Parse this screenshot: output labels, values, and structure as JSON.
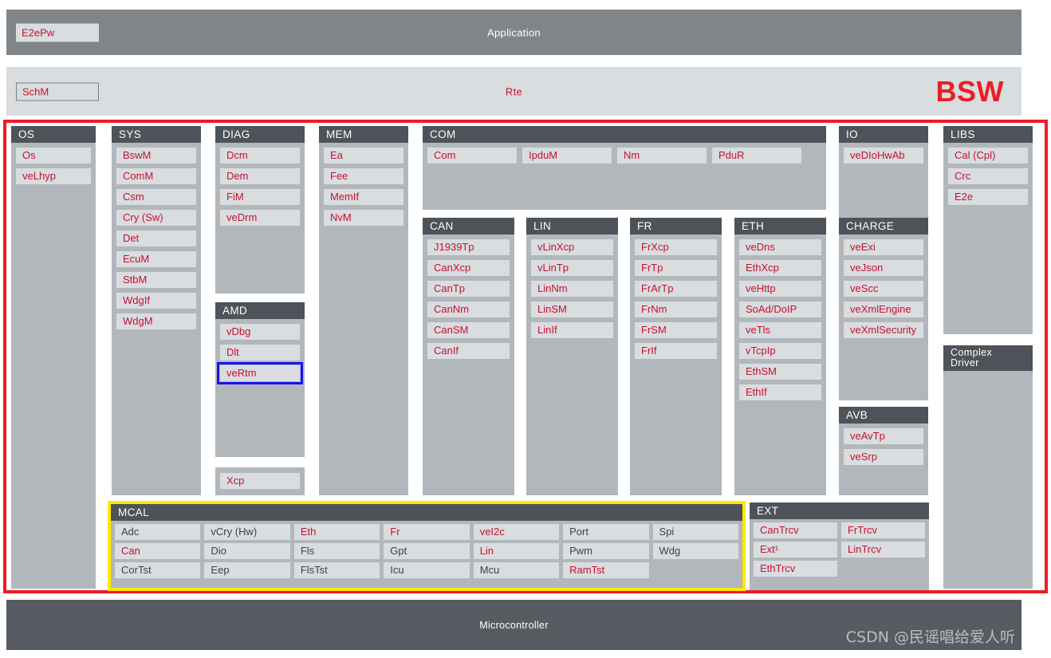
{
  "layers": {
    "application": {
      "title": "Application",
      "chip": "E2ePw"
    },
    "rte": {
      "title": "Rte",
      "chip": "SchM",
      "badge": "BSW"
    },
    "microcontroller": {
      "title": "Microcontroller"
    }
  },
  "watermark": "CSDN @民谣唱给爱人听",
  "colors": {
    "accent_red": "#c8102e",
    "frame_red": "#ee1c25",
    "frame_yellow": "#ffe800",
    "highlight_blue": "#1515ee",
    "header_gray": "#4d5358",
    "body_gray": "#b2b7bc",
    "chip_gray": "#d9dde0",
    "app_bar_gray": "#808589",
    "footer_gray": "#565c61"
  },
  "groups": {
    "os": {
      "title": "OS",
      "items": [
        "Os",
        "veLhyp"
      ]
    },
    "sys": {
      "title": "SYS",
      "items": [
        "BswM",
        "ComM",
        "Csm",
        "Cry (Sw)",
        "Det",
        "EcuM",
        "StbM",
        "WdgIf",
        "WdgM"
      ]
    },
    "diag": {
      "title": "DIAG",
      "items": [
        "Dcm",
        "Dem",
        "FiM",
        "veDrm"
      ]
    },
    "amd": {
      "title": "AMD",
      "items": [
        "vDbg",
        "Dlt",
        "veRtm"
      ],
      "highlighted": "veRtm"
    },
    "xcp": {
      "items": [
        "Xcp"
      ]
    },
    "mem": {
      "title": "MEM",
      "items": [
        "Ea",
        "Fee",
        "MemIf",
        "NvM"
      ]
    },
    "com": {
      "title": "COM",
      "items": [
        "Com",
        "IpduM",
        "Nm",
        "PduR"
      ]
    },
    "can": {
      "title": "CAN",
      "items": [
        "J1939Tp",
        "CanXcp",
        "CanTp",
        "CanNm",
        "CanSM",
        "CanIf"
      ]
    },
    "lin": {
      "title": "LIN",
      "items": [
        "vLinXcp",
        "vLinTp",
        "LinNm",
        "LinSM",
        "LinIf"
      ]
    },
    "fr": {
      "title": "FR",
      "items": [
        "FrXcp",
        "FrTp",
        "FrArTp",
        "FrNm",
        "FrSM",
        "FrIf"
      ]
    },
    "eth": {
      "title": "ETH",
      "items": [
        "veDns",
        "EthXcp",
        "veHttp",
        "SoAd/DoIP",
        "veTls",
        "vTcpIp",
        "EthSM",
        "EthIf"
      ]
    },
    "io": {
      "title": "IO",
      "items": [
        "veDIoHwAb"
      ]
    },
    "charge": {
      "title": "CHARGE",
      "items": [
        "veExi",
        "veJson",
        "veScc",
        "veXmlEngine",
        "veXmlSecurity"
      ]
    },
    "avb": {
      "title": "AVB",
      "items": [
        "veAvTp",
        "veSrp"
      ]
    },
    "libs": {
      "title": "LIBS",
      "items": [
        "Cal (Cpl)",
        "Crc",
        "E2e"
      ]
    },
    "complex_driver": {
      "title": "Complex\nDriver",
      "items": []
    },
    "mcal": {
      "title": "MCAL",
      "columns": [
        {
          "cells": [
            {
              "label": "Adc",
              "red": false
            },
            {
              "label": "Can",
              "red": true
            },
            {
              "label": "CorTst",
              "red": false
            }
          ]
        },
        {
          "cells": [
            {
              "label": "vCry (Hw)",
              "red": false
            },
            {
              "label": "Dio",
              "red": false
            },
            {
              "label": "Eep",
              "red": false
            }
          ]
        },
        {
          "cells": [
            {
              "label": "Eth",
              "red": true
            },
            {
              "label": "Fls",
              "red": false
            },
            {
              "label": "FlsTst",
              "red": false
            }
          ]
        },
        {
          "cells": [
            {
              "label": "Fr",
              "red": true
            },
            {
              "label": "Gpt",
              "red": false
            },
            {
              "label": "Icu",
              "red": false
            }
          ]
        },
        {
          "cells": [
            {
              "label": "veI2c",
              "red": true
            },
            {
              "label": "Lin",
              "red": true
            },
            {
              "label": "Mcu",
              "red": false
            }
          ]
        },
        {
          "cells": [
            {
              "label": "Port",
              "red": false
            },
            {
              "label": "Pwm",
              "red": false
            },
            {
              "label": "RamTst",
              "red": true
            }
          ]
        },
        {
          "cells": [
            {
              "label": "Spi",
              "red": false
            },
            {
              "label": "Wdg",
              "red": false
            },
            {
              "label": "",
              "red": false
            }
          ]
        }
      ]
    },
    "ext": {
      "title": "EXT",
      "columns": [
        {
          "cells": [
            "CanTrcv",
            "Ext¹",
            "EthTrcv"
          ]
        },
        {
          "cells": [
            "FrTrcv",
            "LinTrcv",
            ""
          ]
        }
      ]
    }
  }
}
